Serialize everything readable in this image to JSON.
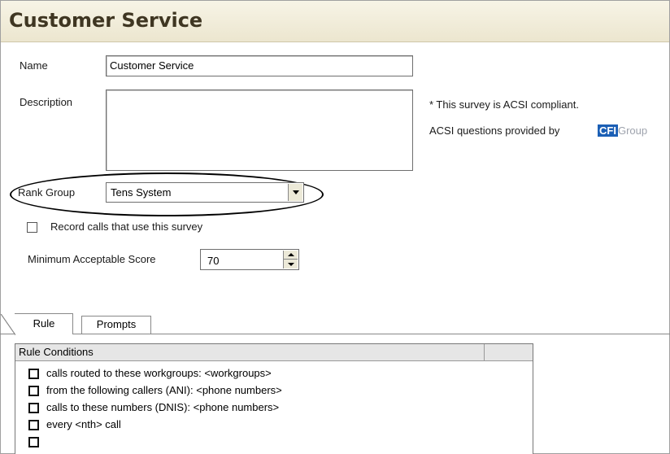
{
  "page": {
    "title": "Customer Service"
  },
  "form": {
    "name_label": "Name",
    "name_value": "Customer Service",
    "description_label": "Description",
    "description_value": "",
    "rank_group_label": "Rank Group",
    "rank_group_value": "Tens System",
    "record_calls_label": "Record calls that use this survey",
    "record_calls_checked": false,
    "min_score_label": "Minimum Acceptable Score",
    "min_score_value": "70"
  },
  "notes": {
    "acsi_compliant": "* This survey is ACSI compliant.",
    "acsi_provided_by": "ACSI questions provided by",
    "logo_text_cfi": "CFI",
    "logo_text_group": "Group"
  },
  "tabs": [
    {
      "label": "Rule",
      "active": true
    },
    {
      "label": "Prompts",
      "active": false
    }
  ],
  "rule_conditions": {
    "header": "Rule Conditions",
    "items": [
      {
        "label": "calls routed to these workgroups: <workgroups>",
        "checked": false
      },
      {
        "label": "from the following callers (ANI): <phone numbers>",
        "checked": false
      },
      {
        "label": "calls to these numbers (DNIS): <phone numbers>",
        "checked": false
      },
      {
        "label": "every <nth> call",
        "checked": false
      },
      {
        "label": "",
        "checked": false
      }
    ]
  },
  "colors": {
    "title_bg": "#ece6cf",
    "title_text": "#3f3622",
    "logo_blue": "#1b5fb5"
  }
}
